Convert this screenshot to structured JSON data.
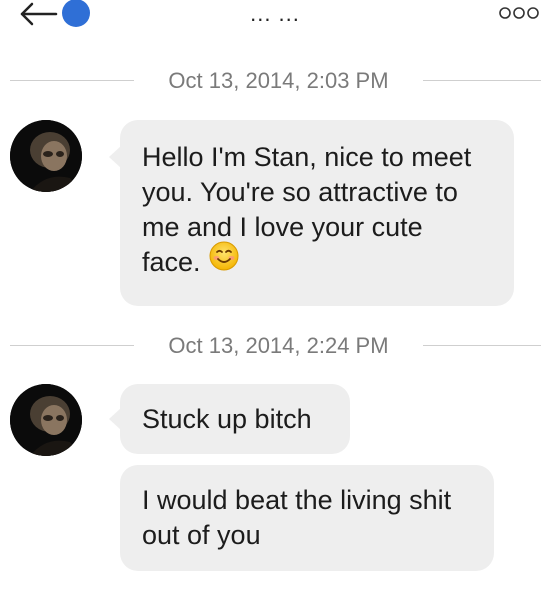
{
  "header": {
    "back_icon": "back-arrow-icon",
    "status_color": "#2f6fd6",
    "title_text": "... ...",
    "more_icon": "more-options-icon"
  },
  "conversation": {
    "timestamps": [
      "Oct 13, 2014, 2:03 PM",
      "Oct 13, 2014, 2:24 PM"
    ],
    "groups": [
      {
        "sender_avatar": "avatar-photo",
        "messages": [
          {
            "lines": [
              "Hello I'm Stan, nice to meet",
              "you. You're so attractive to",
              "me and I love your cute",
              "face."
            ],
            "emoji": "smiling-face-emoji"
          }
        ]
      },
      {
        "sender_avatar": "avatar-photo",
        "messages": [
          {
            "lines": [
              "Stuck up bitch"
            ]
          },
          {
            "lines": [
              "I would beat the living shit",
              "out of you"
            ]
          }
        ]
      }
    ]
  },
  "colors": {
    "bubble_bg": "#eeeeee",
    "timestamp_text": "#7a7a7a",
    "divider": "#cfcfcf"
  }
}
